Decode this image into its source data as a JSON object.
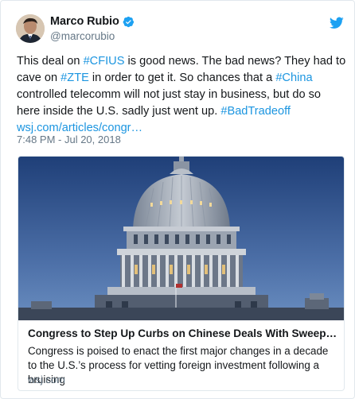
{
  "author": {
    "name": "Marco Rubio",
    "handle": "@marcorubio",
    "verified": true,
    "avatar_icon": "avatar-photo"
  },
  "tweet": {
    "segments": [
      {
        "text": "This deal on ",
        "type": "text"
      },
      {
        "text": "#CFIUS",
        "type": "hashtag"
      },
      {
        "text": " is good news. The bad news? They had to cave on ",
        "type": "text"
      },
      {
        "text": "#ZTE",
        "type": "hashtag"
      },
      {
        "text": " in order to get it. So chances that a ",
        "type": "text"
      },
      {
        "text": "#China",
        "type": "hashtag"
      },
      {
        "text": " controlled telecomm will not just stay in business, but do so here inside the U.S. sadly just went up. ",
        "type": "text"
      },
      {
        "text": "#BadTradeoff",
        "type": "hashtag"
      }
    ],
    "link": "wsj.com/articles/congr…",
    "timestamp": "7:48 PM - Jul 20, 2018"
  },
  "card": {
    "image_subject": "us-capitol-dome-at-dusk",
    "title": "Congress to Step Up Curbs on Chinese Deals With Sweeping …",
    "description": "Congress is poised to enact the first major changes in a decade to the U.S.’s process for vetting foreign investment following a bruising",
    "domain": "wsj.com"
  },
  "colors": {
    "accent": "#1b95e0",
    "text": "#14171a",
    "muted": "#657786",
    "border": "#e1e8ed",
    "sky_top": "#1f3f78",
    "sky_bottom": "#6a8ec0"
  }
}
